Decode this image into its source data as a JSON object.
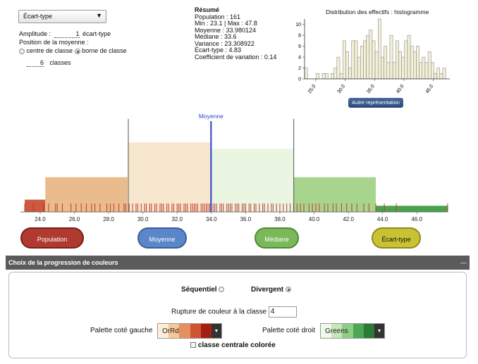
{
  "controls": {
    "method_select": "Écart-type",
    "amplitude_label": "Amplitude :",
    "amplitude_value": "1",
    "amplitude_unit": "écart-type",
    "position_label": "Position de la moyenne :",
    "radio_centre": "centre de classe",
    "radio_borne": "borne de classe",
    "classes_value": "6",
    "classes_label": "classes"
  },
  "summary": {
    "title": "Résumé",
    "population": "Population : 161",
    "minmax": "Min : 23.1 | Max : 47.8",
    "moyenne": "Moyenne : 33.980124",
    "mediane": "Médiane : 33.6",
    "variance": "Variance : 23.308922",
    "ecart_type": "Écart-type : 4.83",
    "cv": "Coefficient de variation : 0.14"
  },
  "histogram": {
    "title": "Distribution des effectifs : histogramme",
    "button": "Autre représentation",
    "y_ticks": [
      "10",
      "8",
      "6",
      "4",
      "2",
      "0"
    ],
    "x_ticks": [
      "25.0",
      "30.0",
      "35.0",
      "40.0",
      "45.0"
    ]
  },
  "chart_data": {
    "type": "bar",
    "title": "Distribution des effectifs : histogramme",
    "xlim": [
      23.1,
      47.8
    ],
    "ylim": [
      0,
      11
    ],
    "bin_width": 0.5,
    "values": [
      2,
      0,
      0,
      0,
      1,
      0,
      1,
      1,
      0,
      1,
      2,
      4,
      1,
      7,
      5,
      2,
      7,
      7,
      4,
      6,
      7,
      8,
      9,
      7,
      5,
      11,
      4,
      6,
      3,
      8,
      3,
      7,
      5,
      4,
      7,
      8,
      6,
      5,
      6,
      3,
      4,
      3,
      5,
      3,
      1,
      2,
      1,
      2,
      0,
      0,
      0,
      0,
      0,
      0,
      0,
      1
    ]
  },
  "main_chart": {
    "moyenne_label": "Moyenne",
    "x_ticks": [
      "24.0",
      "26.0",
      "28.0",
      "30.0",
      "32.0",
      "34.0",
      "36.0",
      "38.0",
      "40.0",
      "42.0",
      "44.0",
      "46.0"
    ],
    "class_bounds": [
      23.1,
      24.3,
      29.1,
      34.0,
      38.8,
      43.6,
      47.8
    ],
    "class_densities": [
      0.3,
      0.85,
      1.7,
      1.55,
      0.85,
      0.15
    ],
    "class_colors": [
      "#cb5a3f",
      "#e9bb8d",
      "#f7e7cf",
      "#eaf5e2",
      "#a8d58e",
      "#4aa24a"
    ],
    "mean": 33.98,
    "std_lines": [
      29.15,
      38.81
    ],
    "observations": [
      23.1,
      23.6,
      24.2,
      24.5,
      24.9,
      25.0,
      25.3,
      25.8,
      26.1,
      26.4,
      26.7,
      27.0,
      27.2,
      27.5,
      27.9,
      28.1,
      28.3,
      28.6,
      28.9,
      29.0,
      29.2,
      29.4,
      29.6,
      29.7,
      29.9,
      30.1,
      30.2,
      30.4,
      30.5,
      30.7,
      30.8,
      31.0,
      31.1,
      31.2,
      31.4,
      31.5,
      31.7,
      31.8,
      32.0,
      32.1,
      32.2,
      32.4,
      32.5,
      32.6,
      32.8,
      32.9,
      33.0,
      33.1,
      33.2,
      33.4,
      33.5,
      33.6,
      33.7,
      33.8,
      33.9,
      34.1,
      34.2,
      34.3,
      34.5,
      34.6,
      34.7,
      34.9,
      35.0,
      35.1,
      35.2,
      35.4,
      35.5,
      35.6,
      35.8,
      35.9,
      36.0,
      36.2,
      36.3,
      36.5,
      36.6,
      36.8,
      37.0,
      37.1,
      37.3,
      37.5,
      37.6,
      37.8,
      38.0,
      38.2,
      38.4,
      38.6,
      38.8,
      39.0,
      39.2,
      39.4,
      39.7,
      39.9,
      40.1,
      40.3,
      40.6,
      40.8,
      41.1,
      41.3,
      41.6,
      41.9,
      42.2,
      42.5,
      42.9,
      43.2,
      43.6,
      44.1,
      44.8,
      47.8
    ]
  },
  "legend_buttons": {
    "population": "Population",
    "moyenne": "Moyenne",
    "mediane": "Médiane",
    "ecart_type": "Écart-type"
  },
  "color_panel": {
    "header": "Choix de la progression de couleurs",
    "collapse": "—",
    "sequentiel": "Séquentiel",
    "divergent": "Divergent",
    "rupture_label": "Rupture de couleur à la classe",
    "rupture_value": "4",
    "palette_left_label": "Palette coté gauche",
    "palette_left_name": "OrRd",
    "palette_left_colors": [
      "#fdeed8",
      "#f7c79a",
      "#e7905f",
      "#cf5434",
      "#a31f12"
    ],
    "palette_right_label": "Palette coté droit",
    "palette_right_name": "Greens",
    "palette_right_colors": [
      "#f0f9ec",
      "#c6e6bb",
      "#8fcd85",
      "#4fa556",
      "#2b7a37"
    ],
    "classe_centrale": "classe centrale colorée"
  }
}
